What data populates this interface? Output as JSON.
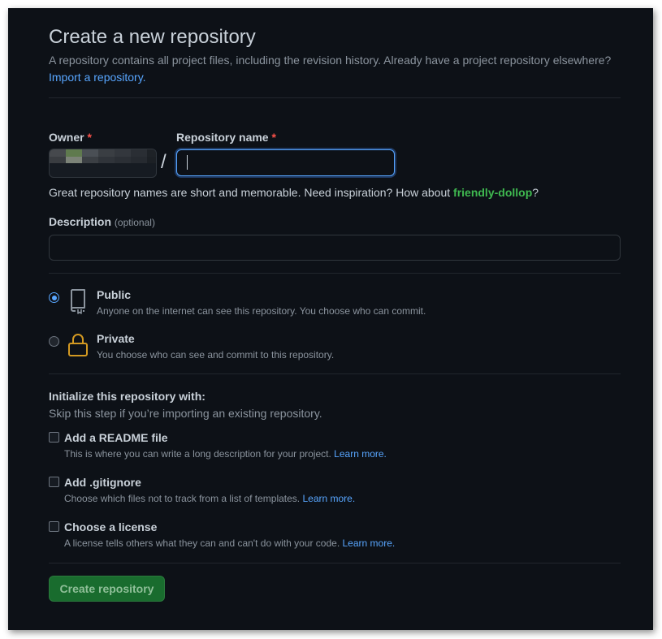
{
  "page": {
    "title": "Create a new repository",
    "subtitle": "A repository contains all project files, including the revision history. Already have a project repository elsewhere?",
    "import_link": "Import a repository."
  },
  "owner": {
    "label": "Owner",
    "required_mark": "*"
  },
  "repo_name": {
    "label": "Repository name",
    "required_mark": "*",
    "separator": "/",
    "value": ""
  },
  "hint": {
    "prefix": "Great repository names are short and memorable. Need inspiration? How about ",
    "suggestion": "friendly-dollop",
    "suffix": "?"
  },
  "description": {
    "label": "Description",
    "optional": "(optional)",
    "value": ""
  },
  "visibility": {
    "selected": "public",
    "public": {
      "title": "Public",
      "desc": "Anyone on the internet can see this repository. You choose who can commit."
    },
    "private": {
      "title": "Private",
      "desc": "You choose who can see and commit to this repository."
    }
  },
  "init": {
    "title": "Initialize this repository with:",
    "subtitle": "Skip this step if you’re importing an existing repository.",
    "readme": {
      "title": "Add a README file",
      "desc": "This is where you can write a long description for your project.",
      "link": "Learn more."
    },
    "gitignore": {
      "title": "Add .gitignore",
      "desc": "Choose which files not to track from a list of templates.",
      "link": "Learn more."
    },
    "license": {
      "title": "Choose a license",
      "desc": "A license tells others what they can and can't do with your code.",
      "link": "Learn more."
    }
  },
  "actions": {
    "create_label": "Create repository"
  },
  "colors": {
    "background": "#0d1117",
    "link": "#58a6ff",
    "suggestion": "#3fb950",
    "required": "#f85149",
    "button": "#196c2e",
    "lock_icon": "#d29922"
  }
}
